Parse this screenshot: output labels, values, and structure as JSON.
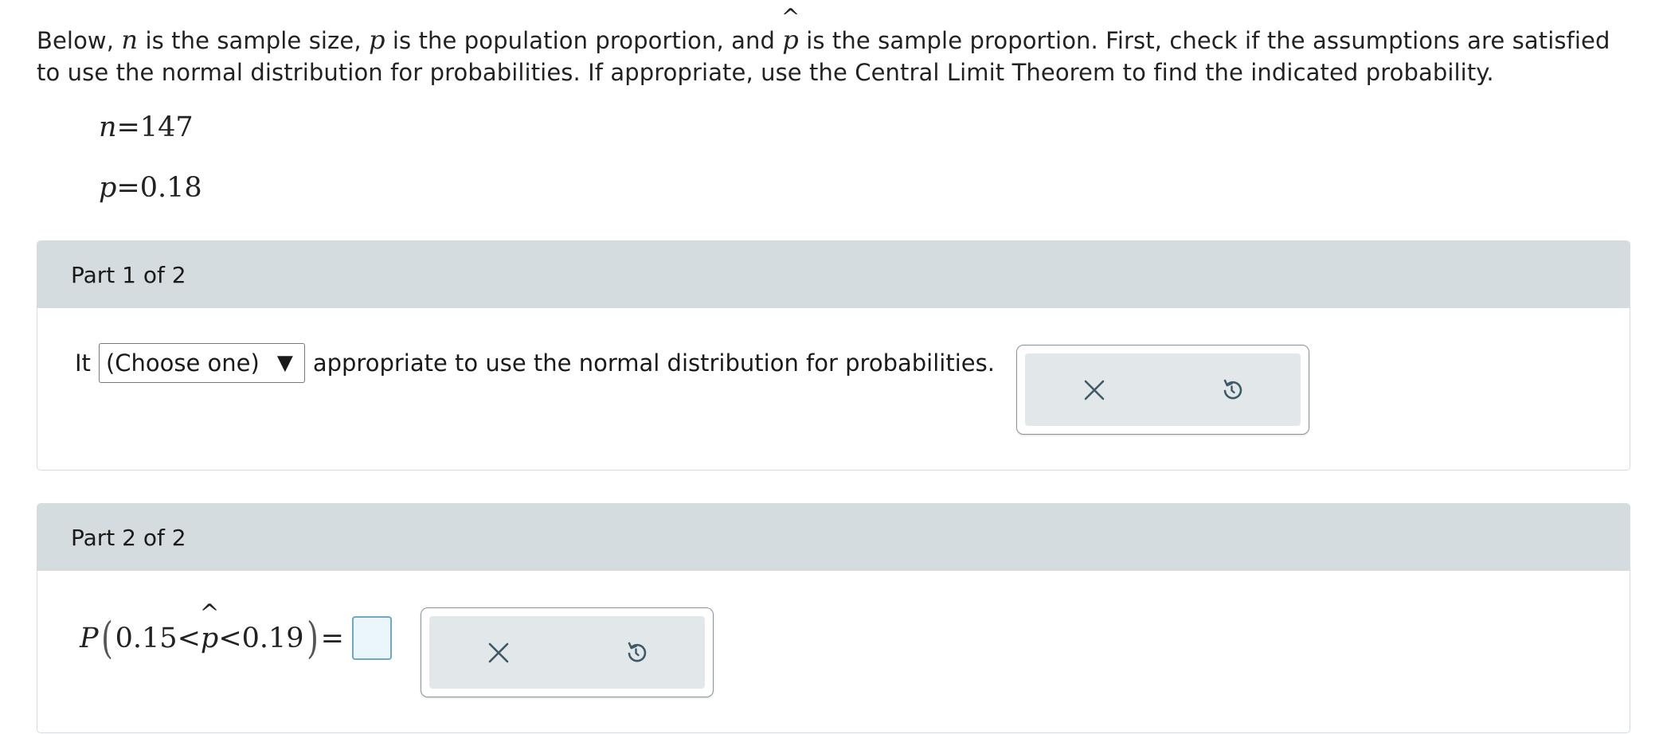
{
  "intro": {
    "t1": "Below, ",
    "n": "n",
    "t2": " is the sample size, ",
    "p": "p",
    "t3": " is the population proportion, and ",
    "phat": "p",
    "t4": " is the sample proportion. First, check if the assumptions are satisfied to use the normal distribution for probabilities. If appropriate, use the Central Limit Theorem to find the indicated probability."
  },
  "given": {
    "n_var": "n",
    "n_value": "=147",
    "p_var": "p",
    "p_value": "=0.18"
  },
  "part1": {
    "header": "Part 1 of 2",
    "prefix": "It",
    "dropdown_value": "(Choose one)",
    "dropdown_arrow": "▼",
    "suffix": "appropriate to use the normal distribution for probabilities."
  },
  "part2": {
    "header": "Part 2 of 2",
    "expr_P": "P",
    "expr_open": "(",
    "expr_left": "0.15<",
    "expr_phat": "p",
    "expr_right": "<0.19",
    "expr_close": ")",
    "expr_eq": "="
  },
  "icons": {
    "clear": "close-icon",
    "undo": "undo-icon",
    "caret": "^"
  },
  "colors": {
    "part_header_bg": "#d4dcdf",
    "tool_bg": "#e2e7ea",
    "icon": "#3e5a66",
    "answer_box_border": "#6ea8c2"
  }
}
